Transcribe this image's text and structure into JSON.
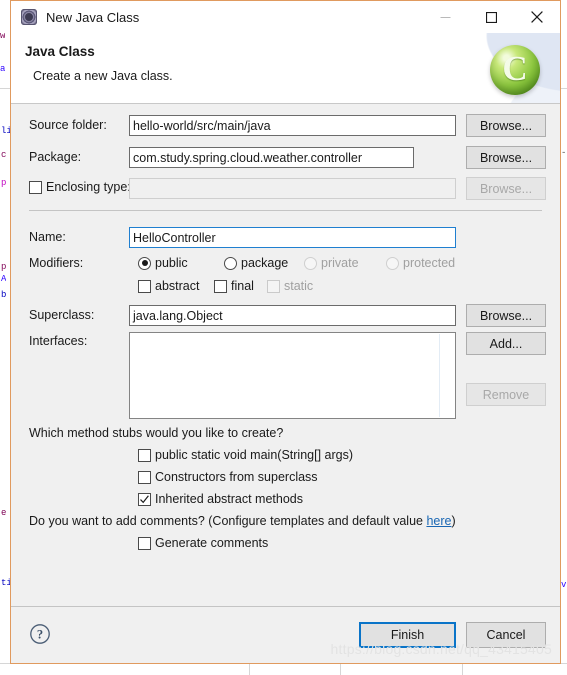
{
  "window": {
    "title": "New Java Class",
    "icon": "java-class-icon",
    "minimize_label": "—",
    "maximize_label": "☐",
    "close_label": "✕"
  },
  "header": {
    "title": "Java Class",
    "subtitle": "Create a new Java class.",
    "logo": "eclipse-c-logo"
  },
  "form": {
    "source_folder": {
      "label": "Source folder:",
      "value": "hello-world/src/main/java",
      "browse_label": "Browse..."
    },
    "package": {
      "label": "Package:",
      "value": "com.study.spring.cloud.weather.controller",
      "browse_label": "Browse..."
    },
    "enclosing_type": {
      "label": "Enclosing type:",
      "checked": false,
      "value": "",
      "browse_label": "Browse...",
      "disabled": true
    },
    "name": {
      "label": "Name:",
      "value": "HelloController"
    },
    "modifiers": {
      "label": "Modifiers:",
      "radios": [
        {
          "label": "public",
          "selected": true,
          "disabled": false
        },
        {
          "label": "package",
          "selected": false,
          "disabled": false
        },
        {
          "label": "private",
          "selected": false,
          "disabled": true
        },
        {
          "label": "protected",
          "selected": false,
          "disabled": true
        }
      ],
      "checkboxes": [
        {
          "label": "abstract",
          "checked": false,
          "disabled": false
        },
        {
          "label": "final",
          "checked": false,
          "disabled": false
        },
        {
          "label": "static",
          "checked": false,
          "disabled": true
        }
      ]
    },
    "superclass": {
      "label": "Superclass:",
      "value": "java.lang.Object",
      "browse_label": "Browse..."
    },
    "interfaces": {
      "label": "Interfaces:",
      "items": [],
      "add_label": "Add...",
      "remove_label": "Remove",
      "remove_disabled": true
    },
    "stubs": {
      "question": "Which method stubs would you like to create?",
      "options": [
        {
          "label": "public static void main(String[] args)",
          "checked": false
        },
        {
          "label": "Constructors from superclass",
          "checked": false
        },
        {
          "label": "Inherited abstract methods",
          "checked": true
        }
      ]
    },
    "comments": {
      "question_prefix": "Do you want to add comments? (Configure templates and default value ",
      "link_label": "here",
      "question_suffix": ")",
      "option": {
        "label": "Generate comments",
        "checked": false
      }
    }
  },
  "footer": {
    "help_label": "?",
    "finish_label": "Finish",
    "cancel_label": "Cancel"
  },
  "watermark": {
    "text": "https://blog.csdn.net/qq_43415405"
  },
  "colors": {
    "accent": "#0a74c8",
    "dialog_border": "#e09a5e",
    "dialog_bg": "#f0f0f0",
    "link": "#1966b3",
    "logo_green": "#8cc63f"
  }
}
